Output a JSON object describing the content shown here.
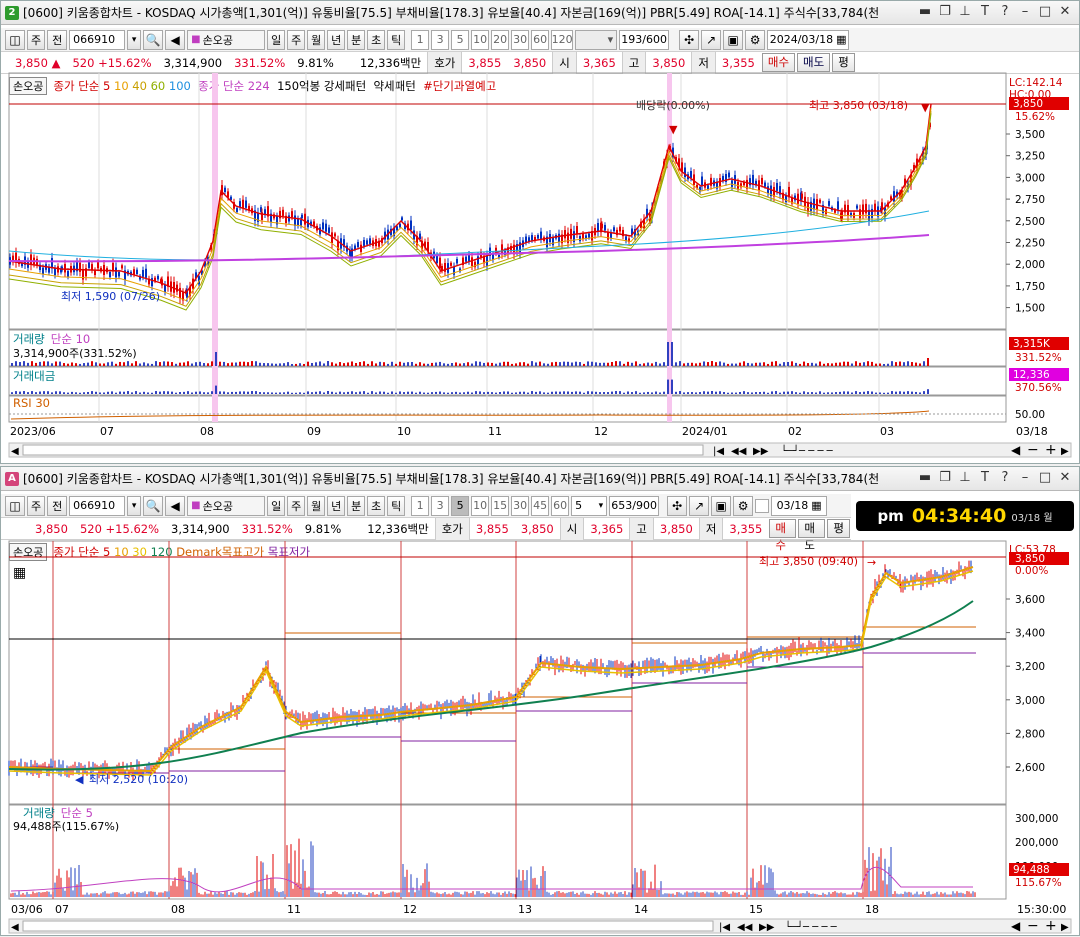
{
  "top": {
    "num": "2",
    "num_color": "#2d9b2d",
    "title": "[0600] 키움종합차트 - KOSDAQ 시가총액[1,301(억)] 유통비율[75.5] 부채비율[178.3] 유보율[40.4] 자본금[169(억)] PBR[5.49] ROA[-14.1] 주식수[33,784(천",
    "toolbar": {
      "tab1": "주",
      "tab2": "전",
      "code": "066910",
      "name": "손오공",
      "periods": [
        "일",
        "주",
        "월",
        "년",
        "분",
        "초",
        "틱"
      ],
      "nums": [
        "1",
        "3",
        "5",
        "10",
        "20",
        "30",
        "60",
        "120"
      ],
      "count": "193",
      "count_total": "/600",
      "date": "2024/03/18"
    },
    "stock": {
      "price": "3,850",
      "arrow": "▲",
      "change": "520",
      "pct": "+15.62%",
      "volume": "3,314,900",
      "vol_pct": "331.52%",
      "turnover": "9.81%",
      "amount": "12,336백만",
      "hoga_label": "호가",
      "hoga1": "3,855",
      "hoga2": "3,850",
      "open_label": "시",
      "open": "3,365",
      "high_label": "고",
      "high": "3,850",
      "low_label": "저",
      "low": "3,355",
      "buy": "매수",
      "sell": "매도",
      "eval": "평"
    },
    "legend": [
      "손오공",
      "종가 단순",
      "5",
      "10",
      "40",
      "60",
      "100",
      "종가 단순 224",
      "150억봉 강세패턴",
      "약세패턴",
      "#단기과열예고"
    ],
    "annotations": {
      "div": "배당락(0.00%)",
      "high": "최고 3,850 (03/18)",
      "low": "최저 1,590 (07/26)"
    },
    "right_labels": {
      "lc": "LC:142.14",
      "hc": "HC:0.00",
      "price": "3,850",
      "pct": "15.62%"
    },
    "y_ticks": [
      "3,500",
      "3,250",
      "3,000",
      "2,750",
      "2,500",
      "2,250",
      "2,000",
      "1,750",
      "1,500"
    ],
    "volume_panel": {
      "title": "거래량",
      "ma": "단순 10",
      "value": "3,314,900주(331.52%)",
      "right": "3,315K",
      "right_pct": "331.52%"
    },
    "amount_panel": {
      "title": "거래대금",
      "right": "12,336",
      "right_pct": "370.56%"
    },
    "rsi_panel": {
      "title": "RSI 30",
      "tick": "50.00"
    },
    "x_labels": [
      "2023/06",
      "07",
      "08",
      "09",
      "10",
      "11",
      "12",
      "2024/01",
      "02",
      "03",
      "03/18"
    ]
  },
  "bottom": {
    "num": "A",
    "num_color": "#d4447a",
    "title": "[0600] 키움종합차트 - KOSDAQ 시가총액[1,301(억)] 유통비율[75.5] 부채비율[178.3] 유보율[40.4] 자본금[169(억)] PBR[5.49] ROA[-14.1] 주식수[33,784(천",
    "toolbar": {
      "tab1": "주",
      "tab2": "전",
      "code": "066910",
      "name": "손오공",
      "periods": [
        "일",
        "주",
        "월",
        "년",
        "분",
        "초",
        "틱"
      ],
      "nums": [
        "1",
        "3",
        "5",
        "10",
        "15",
        "30",
        "45",
        "60"
      ],
      "unit": "5",
      "count": "653",
      "count_total": "/900",
      "date": "03/18"
    },
    "stock": {
      "price": "3,850",
      "change": "520",
      "pct": "+15.62%",
      "volume": "3,314,900",
      "vol_pct": "331.52%",
      "turnover": "9.81%",
      "amount": "12,336백만",
      "hoga_label": "호가",
      "hoga1": "3,855",
      "hoga2": "3,850",
      "open_label": "시",
      "open": "3,365",
      "high_label": "고",
      "high": "3,850",
      "low_label": "저",
      "low": "3,355",
      "buy": "매수",
      "sell": "매도",
      "eval": "평"
    },
    "clock": {
      "ampm": "pm",
      "time": "04:34:40",
      "date": "03/18 월"
    },
    "legend": [
      "손오공",
      "종가 단순",
      "5",
      "10",
      "30",
      "120",
      "Demark목표고가",
      "목표저가"
    ],
    "annotations": {
      "high": "최고 3,850 (09:40)",
      "low": "최저 2,520 (10:20)"
    },
    "right_labels": {
      "lc": "LC:53.78",
      "price": "3,850",
      "pct": "0.00%"
    },
    "y_ticks": [
      "3,600",
      "3,400",
      "3,200",
      "3,000",
      "2,800",
      "2,600"
    ],
    "volume_panel": {
      "title": "거래량",
      "ma": "단순 5",
      "value": "94,488주(115.67%)",
      "right": "94,488",
      "right_pct": "115.67%"
    },
    "vol_ticks": [
      "300,000",
      "200,000",
      "100,000"
    ],
    "x_labels": [
      "03/06",
      "07",
      "08",
      "11",
      "12",
      "13",
      "14",
      "15",
      "18",
      "15:30:00"
    ]
  }
}
